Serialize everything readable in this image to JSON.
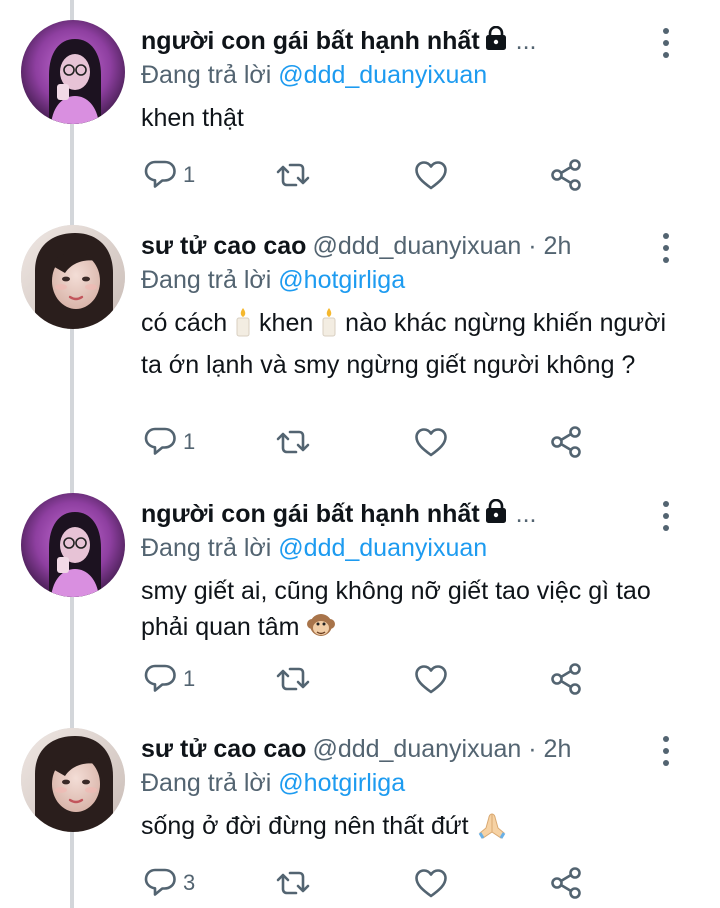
{
  "tweets": [
    {
      "name": "người con gái bất hạnh nhất",
      "handle": "",
      "time": "",
      "reply_prefix": "Đang trả lời ",
      "reply_to": "@ddd_duanyixuan",
      "text": "khen thật",
      "reply_count": "1",
      "avatar": "girl-glasses-purple",
      "locked": true
    },
    {
      "name": "sư tử cao cao",
      "handle": "@ddd_duanyixuan",
      "time": "· 2h",
      "reply_prefix": "Đang trả lời ",
      "reply_to": "@hotgirliga",
      "text_parts": [
        "có cách ",
        " khen ",
        " nào khác ngừng khiến người ta ớn lạnh và smy ngừng giết người không ?"
      ],
      "reply_count": "1",
      "avatar": "girl-face-closeup",
      "locked": false
    },
    {
      "name": "người con gái bất hạnh nhất",
      "handle": "",
      "time": "",
      "reply_prefix": "Đang trả lời ",
      "reply_to": "@ddd_duanyixuan",
      "text": "smy giết ai, cũng không nỡ giết tao việc gì tao phải quan tâm",
      "reply_count": "1",
      "avatar": "girl-glasses-purple",
      "locked": true
    },
    {
      "name": "sư tử cao cao",
      "handle": "@ddd_duanyixuan",
      "time": "· 2h",
      "reply_prefix": "Đang trả lời ",
      "reply_to": "@hotgirliga",
      "text": "sống ở đời đừng nên thất đứt",
      "reply_count": "3",
      "avatar": "girl-face-closeup",
      "locked": false
    }
  ],
  "icons": {
    "reply": "reply-icon",
    "retweet": "retweet-icon",
    "like": "heart-icon",
    "share": "share-icon",
    "more": "more-vertical-icon",
    "lock": "lock-icon",
    "candle": "candle-emoji",
    "monkey": "monkey-emoji",
    "pray": "praying-hands-emoji"
  },
  "colors": {
    "text": "#0f1419",
    "secondary": "#536471",
    "link": "#1d9bf0",
    "thread_line": "#d3d6da"
  }
}
